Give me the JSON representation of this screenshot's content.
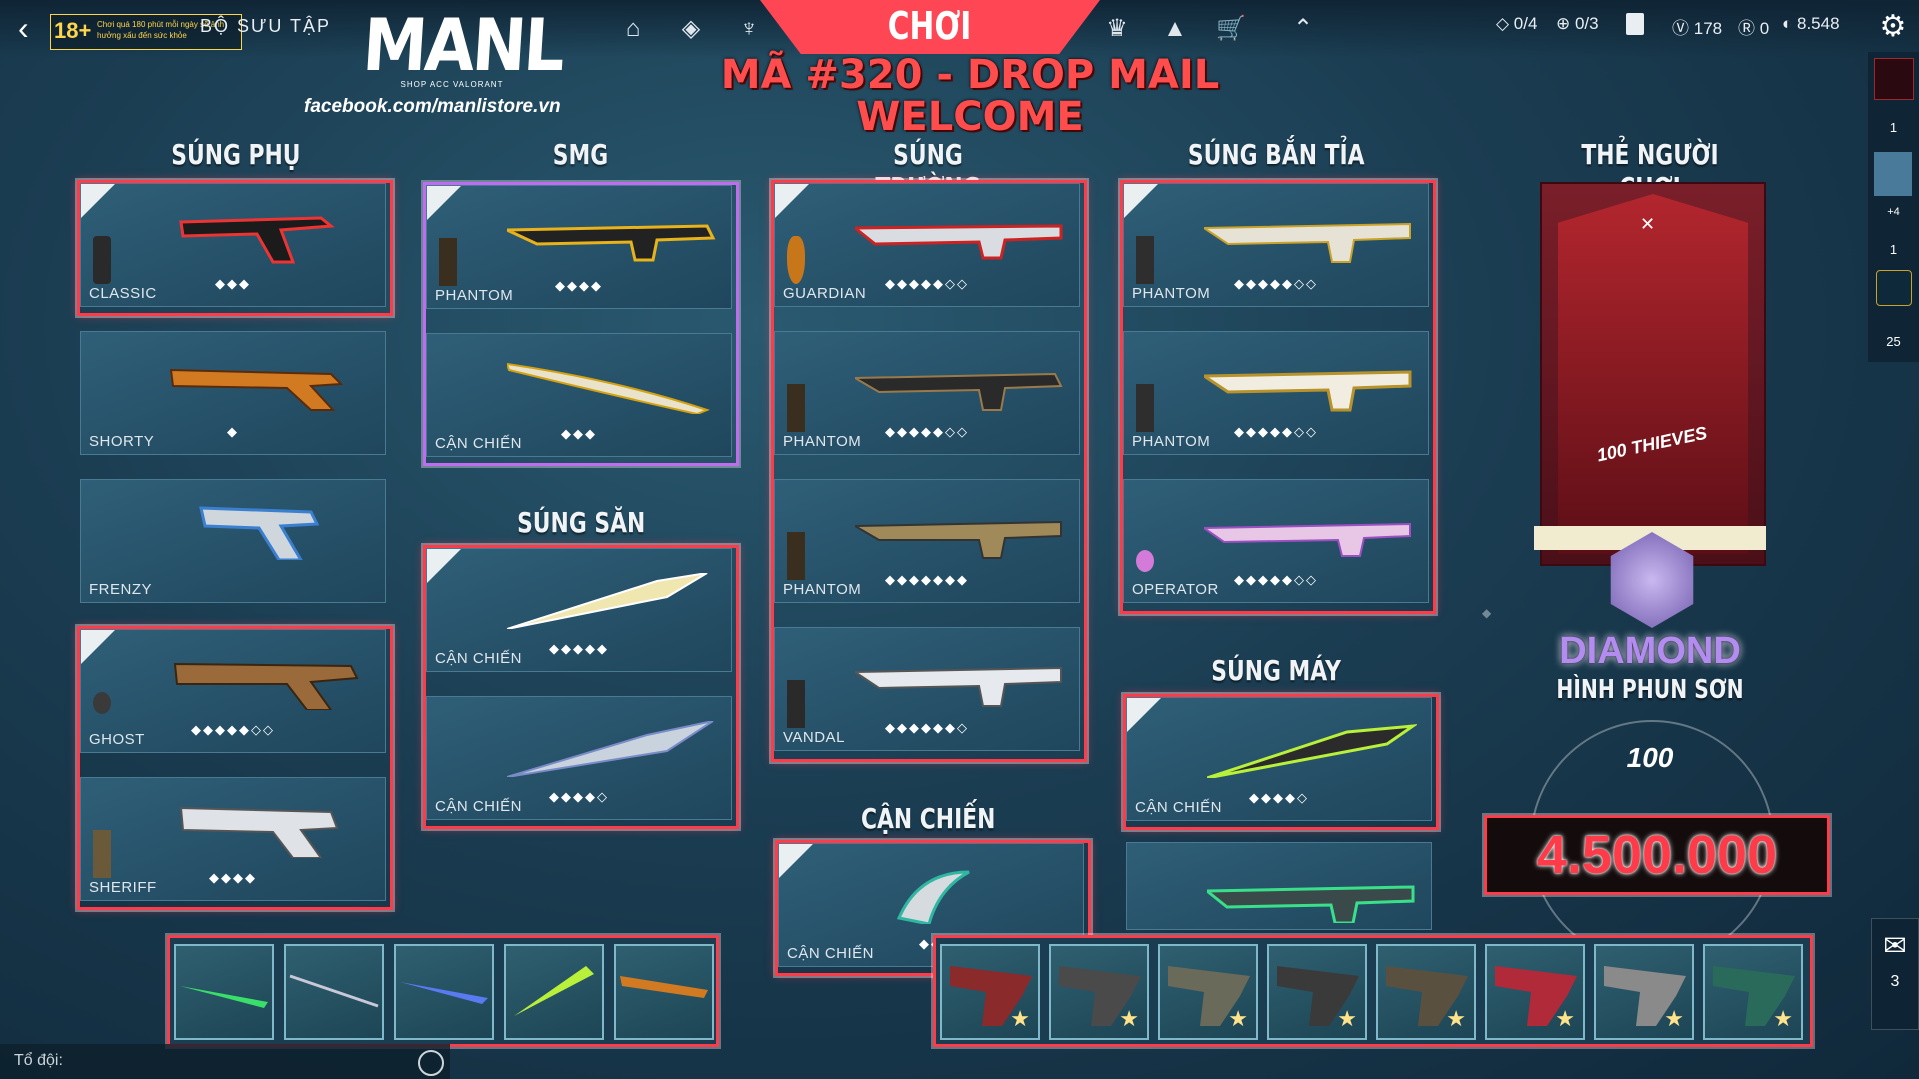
{
  "topbar": {
    "back_label": "BỘ SƯU TẬP",
    "age_badge": "18+",
    "age_notice": "Chơi quá 180 phút mỗi ngày sẽ ảnh hưởng xấu đến sức khỏe",
    "play_label": "CHƠI",
    "currencies": {
      "quest_a": "0/4",
      "quest_b": "0/3",
      "vp": "178",
      "radianite": "0",
      "kingdom": "8.548"
    }
  },
  "banner": {
    "brand": "MANL",
    "brand_sub": "SHOP ACC VALORANT",
    "facebook": "facebook.com/manlistore.vn",
    "code_line": "MÃ #320 - DROP MAIL",
    "welcome": "WELCOME"
  },
  "sections": {
    "sidearms": "SÚNG PHỤ",
    "smg": "SMG",
    "rifles": "SÚNG TRƯỜNG",
    "snipers": "SÚNG BẮN TỈA",
    "shotguns": "SÚNG SĂN",
    "machine_guns": "SÚNG MÁY",
    "melee": "CẬN CHIẾN",
    "player_card": "THẺ NGƯỜI CHƠI"
  },
  "sidearms": [
    {
      "name": "CLASSIC",
      "level": "◆◆◆"
    },
    {
      "name": "SHORTY",
      "level": "◆"
    },
    {
      "name": "FRENZY",
      "level": ""
    },
    {
      "name": "GHOST",
      "level": "◆◆◆◆◆◇◇"
    },
    {
      "name": "SHERIFF",
      "level": "◆◆◆◆"
    }
  ],
  "smg": [
    {
      "name": "PHANTOM",
      "level": "◆◆◆◆"
    },
    {
      "name": "CẬN CHIẾN",
      "level": "◆◆◆"
    }
  ],
  "shotguns": [
    {
      "name": "CẬN CHIẾN",
      "level": "◆◆◆◆◆"
    },
    {
      "name": "CẬN CHIẾN",
      "level": "◆◆◆◆◇"
    }
  ],
  "rifles": [
    {
      "name": "GUARDIAN",
      "level": "◆◆◆◆◆◇◇"
    },
    {
      "name": "PHANTOM",
      "level": "◆◆◆◆◆◇◇"
    },
    {
      "name": "PHANTOM",
      "level": "◆◆◆◆◆◆◆"
    },
    {
      "name": "VANDAL",
      "level": "◆◆◆◆◆◆◇"
    }
  ],
  "snipers": [
    {
      "name": "PHANTOM",
      "level": "◆◆◆◆◆◇◇"
    },
    {
      "name": "PHANTOM",
      "level": "◆◆◆◆◆◇◇"
    },
    {
      "name": "OPERATOR",
      "level": "◆◆◆◆◆◇◇"
    }
  ],
  "machine_guns": [
    {
      "name": "CẬN CHIẾN",
      "level": "◆◆◆◆◇"
    },
    {
      "name": "",
      "level": ""
    }
  ],
  "melee": [
    {
      "name": "CẬN CHIẾN",
      "level": "◆◆"
    }
  ],
  "player_card": {
    "rank": "DIAMOND",
    "spray_label": "HÌNH PHUN SƠN",
    "price": "4.500.000",
    "team": "100 THIEVES"
  },
  "right_rail": {
    "items": [
      "1",
      "+4",
      "1",
      "25"
    ],
    "mail_count": "3"
  },
  "chat": {
    "label": "Tổ đội:"
  },
  "colors": {
    "accent_red": "#ff4655",
    "frame_red": "#ff3b4a",
    "frame_purple": "#c06cf0",
    "rank_purple": "#b38cf0"
  }
}
